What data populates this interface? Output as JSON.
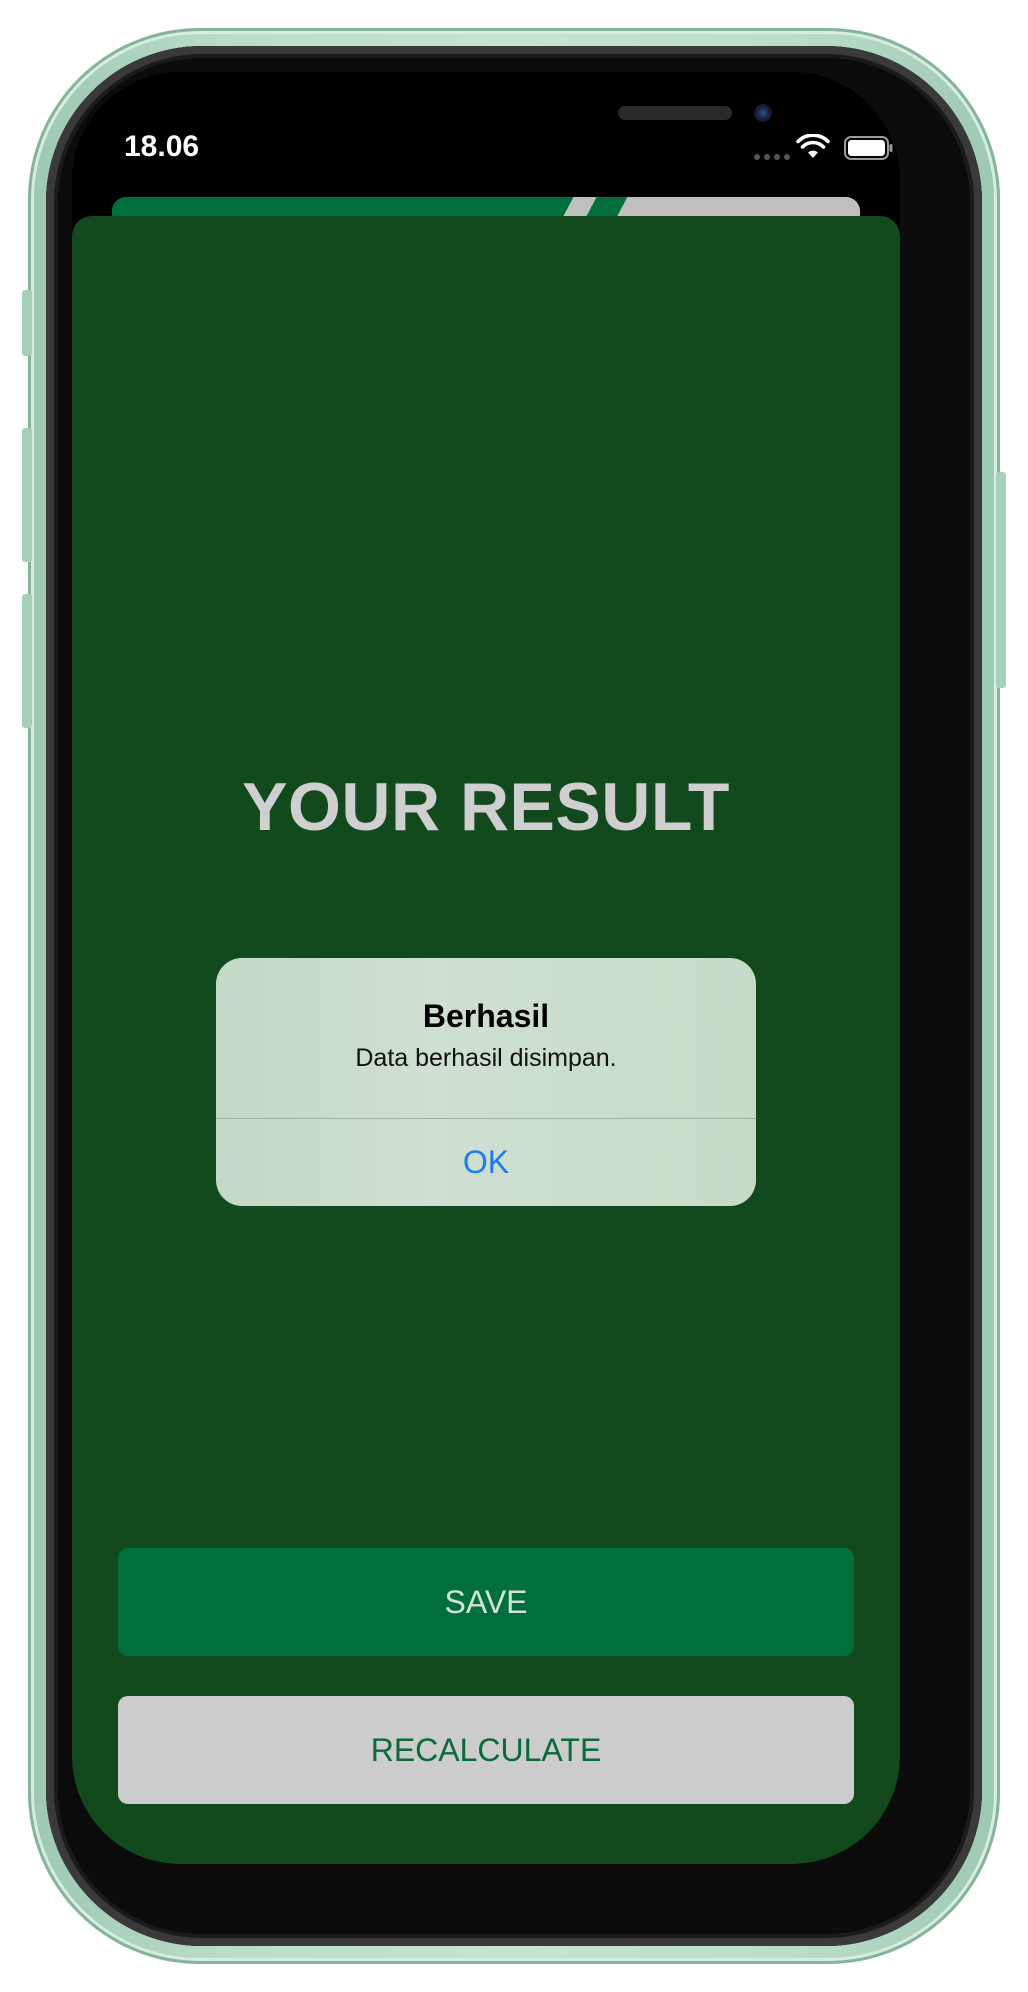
{
  "status_bar": {
    "time": "18.06"
  },
  "result": {
    "title": "YOUR RESULT"
  },
  "alert": {
    "title": "Berhasil",
    "message": "Data berhasil disimpan.",
    "ok_label": "OK"
  },
  "actions": {
    "save_label": "SAVE",
    "recalculate_label": "RECALCULATE"
  },
  "colors": {
    "background": "#124a1e",
    "primary_button": "#006f3c",
    "secondary_button": "#cccccc",
    "alert_action": "#1a7cf0",
    "device_frame": "#b9dcc8"
  },
  "icons": [
    "wifi-icon",
    "battery-icon",
    "signal-dots-icon"
  ]
}
